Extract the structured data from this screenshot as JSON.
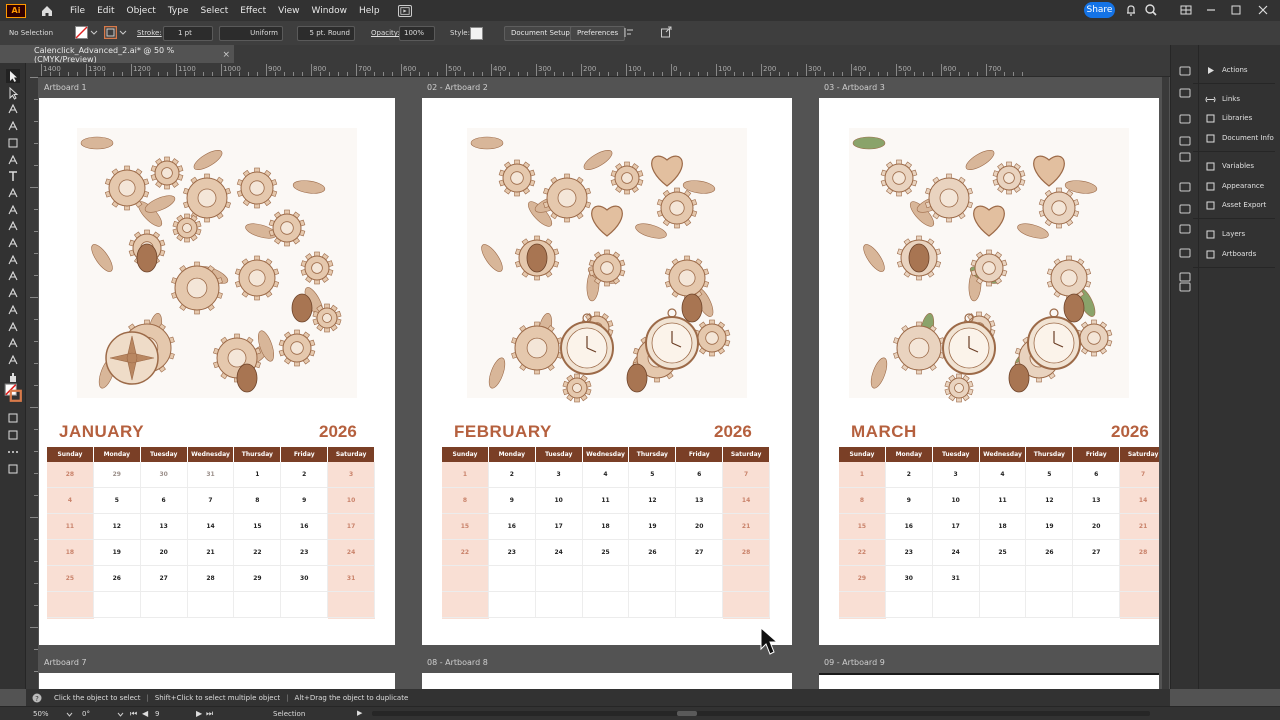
{
  "app": {
    "logo_text": "Ai",
    "menus": [
      "File",
      "Edit",
      "Object",
      "Type",
      "Select",
      "Effect",
      "View",
      "Window",
      "Help"
    ],
    "share_label": "Share"
  },
  "control_bar": {
    "selection_status": "No Selection",
    "stroke_label": "Stroke:",
    "stroke_value": "1 pt",
    "profile_value": "Uniform",
    "brush_value": "5 pt. Round",
    "opacity_label": "Opacity:",
    "opacity_value": "100%",
    "style_label": "Style:",
    "document_setup_label": "Document Setup",
    "preferences_label": "Preferences"
  },
  "document_tab": {
    "title": "Calenclick_Advanced_2.ai* @ 50 % (CMYK/Preview)",
    "close_icon": "×"
  },
  "ruler_labels": [
    "1400",
    "1300",
    "1200",
    "1100",
    "1000",
    "900",
    "800",
    "700",
    "600",
    "500",
    "400",
    "300",
    "200",
    "100",
    "0",
    "100",
    "200",
    "300",
    "400",
    "500",
    "600",
    "700"
  ],
  "weekdays": [
    "Sunday",
    "Monday",
    "Tuesday",
    "Wednesday",
    "Thursday",
    "Friday",
    "Saturday"
  ],
  "artboards": [
    {
      "label": "Artboard 1",
      "month": "JANUARY",
      "year": "2026",
      "rows": [
        [
          "28",
          "29",
          "30",
          "31",
          "1",
          "2",
          "3"
        ],
        [
          "4",
          "5",
          "6",
          "7",
          "8",
          "9",
          "10"
        ],
        [
          "11",
          "12",
          "13",
          "14",
          "15",
          "16",
          "17"
        ],
        [
          "18",
          "19",
          "20",
          "21",
          "22",
          "23",
          "24"
        ],
        [
          "25",
          "26",
          "27",
          "28",
          "29",
          "30",
          "31"
        ],
        [
          "",
          "",
          "",
          "",
          "",
          "",
          ""
        ]
      ]
    },
    {
      "label": "02 - Artboard 2",
      "month": "FEBRUARY",
      "year": "2026",
      "rows": [
        [
          "1",
          "2",
          "3",
          "4",
          "5",
          "6",
          "7"
        ],
        [
          "8",
          "9",
          "10",
          "11",
          "12",
          "13",
          "14"
        ],
        [
          "15",
          "16",
          "17",
          "18",
          "19",
          "20",
          "21"
        ],
        [
          "22",
          "23",
          "24",
          "25",
          "26",
          "27",
          "28"
        ],
        [
          "",
          "",
          "",
          "",
          "",
          "",
          ""
        ],
        [
          "",
          "",
          "",
          "",
          "",
          "",
          ""
        ]
      ]
    },
    {
      "label": "03 - Artboard 3",
      "month": "MARCH",
      "year": "2026",
      "rows": [
        [
          "1",
          "2",
          "3",
          "4",
          "5",
          "6",
          "7"
        ],
        [
          "8",
          "9",
          "10",
          "11",
          "12",
          "13",
          "14"
        ],
        [
          "15",
          "16",
          "17",
          "18",
          "19",
          "20",
          "21"
        ],
        [
          "22",
          "23",
          "24",
          "25",
          "26",
          "27",
          "28"
        ],
        [
          "29",
          "30",
          "31",
          "",
          "",
          "",
          ""
        ],
        [
          "",
          "",
          "",
          "",
          "",
          "",
          ""
        ]
      ]
    }
  ],
  "lower_artboards": [
    "Artboard 7",
    "08 - Artboard 8",
    "09 - Artboard 9"
  ],
  "panels": [
    {
      "label": "Actions",
      "icon": "play-icon"
    },
    {
      "label": "Links",
      "icon": "link-icon"
    },
    {
      "label": "Libraries",
      "icon": "library-icon"
    },
    {
      "label": "Document Info",
      "icon": "info-icon"
    },
    {
      "label": "Variables",
      "icon": "variables-icon"
    },
    {
      "label": "Appearance",
      "icon": "appearance-icon"
    },
    {
      "label": "Asset Export",
      "icon": "export-icon"
    },
    {
      "label": "Layers",
      "icon": "layers-icon"
    },
    {
      "label": "Artboards",
      "icon": "artboards-icon"
    }
  ],
  "hint_bar": {
    "hint1": "Click the object to select",
    "hint2": "Shift+Click to select multiple object",
    "hint3": "Alt+Drag the object to duplicate"
  },
  "status_bar": {
    "zoom": "50%",
    "rotation": "0°",
    "artboard_number": "9",
    "tool_name": "Selection"
  },
  "colors": {
    "accent": "#b5603e",
    "header_bar": "#7a3f26",
    "weekend_fill": "#f9dfd4",
    "share_blue": "#1473e6"
  }
}
